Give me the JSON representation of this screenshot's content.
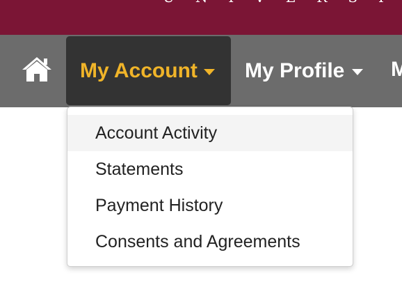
{
  "banner": {
    "text": "UNIVERSITY",
    "background_color": "#7b1535"
  },
  "navbar": {
    "background_color": "#6c6c6c",
    "home_icon": "home-icon",
    "items": [
      {
        "label": "My Account",
        "active": true,
        "color": "#f0b429",
        "has_dropdown": true
      },
      {
        "label": "My Profile",
        "active": false,
        "color": "#ffffff",
        "has_dropdown": true
      },
      {
        "label": "M",
        "active": false,
        "color": "#ffffff",
        "truncated": true
      }
    ]
  },
  "dropdown": {
    "items": [
      {
        "label": "Account Activity",
        "highlighted": true
      },
      {
        "label": "Statements",
        "highlighted": false
      },
      {
        "label": "Payment History",
        "highlighted": false
      },
      {
        "label": "Consents and Agreements",
        "highlighted": false
      }
    ]
  }
}
